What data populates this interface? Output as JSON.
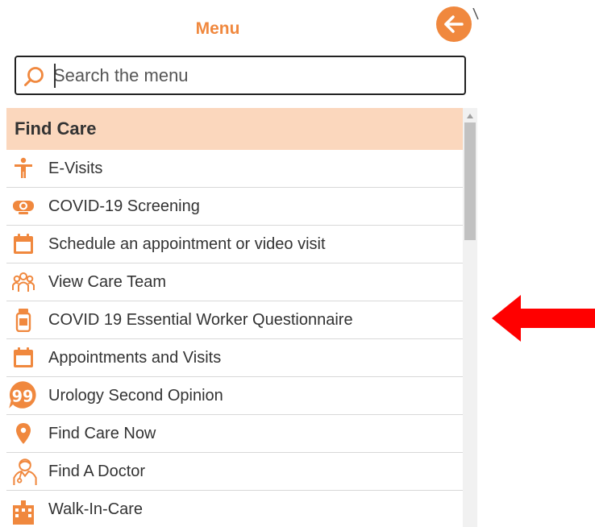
{
  "header": {
    "title": "Menu",
    "back_icon": "arrow-left-icon"
  },
  "search": {
    "placeholder": "Search the menu",
    "value": ""
  },
  "section": {
    "title": "Find Care"
  },
  "items": [
    {
      "label": "E-Visits",
      "icon": "person-icon"
    },
    {
      "label": "COVID-19 Screening",
      "icon": "webcam-icon"
    },
    {
      "label": "Schedule an appointment or video visit",
      "icon": "calendar-icon"
    },
    {
      "label": "View Care Team",
      "icon": "group-icon"
    },
    {
      "label": "COVID 19 Essential Worker Questionnaire",
      "icon": "medicine-bottle-icon"
    },
    {
      "label": "Appointments and Visits",
      "icon": "calendar-icon"
    },
    {
      "label": "Urology Second Opinion",
      "icon": "quote-bubble-icon"
    },
    {
      "label": "Find Care Now",
      "icon": "map-pin-icon"
    },
    {
      "label": "Find A Doctor",
      "icon": "doctor-icon"
    },
    {
      "label": "Walk-In-Care",
      "icon": "building-icon"
    }
  ],
  "colors": {
    "accent": "#f0883e",
    "section_bg": "#fbd7bd",
    "annotation_arrow": "#ff0000"
  }
}
